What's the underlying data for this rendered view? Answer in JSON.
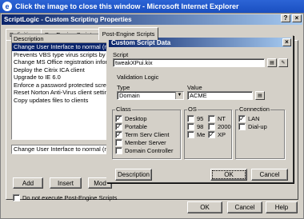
{
  "ie_window": {
    "title": "Click the image to close this window - Microsoft Internet Explorer"
  },
  "properties": {
    "title": "ScriptLogic - Custom Scripting Properties",
    "tabs": [
      "Definitions",
      "Pre-Engine Scripts",
      "Post-Engine Scripts"
    ],
    "list_header": "Description",
    "items": [
      "Change User Interface to normal (non-XP",
      "Prevents VBS type virus scripts by de-as",
      "Change MS Office registration informatio",
      "Deploy the Citrix ICA client",
      "Upgrade to IE 6.0",
      "Enforce a password protected screen sa",
      "Reset Norton Anti-Virus client settings",
      "Copy updates files to clients"
    ],
    "selected_description": "Change User Interface to normal (non-XP",
    "buttons": {
      "add": "Add",
      "insert": "Insert",
      "modify": "Mod"
    },
    "do_not_execute_label": "Do not execute Post-Engine Scripts",
    "footer": {
      "ok": "OK",
      "cancel": "Cancel",
      "help": "Help"
    }
  },
  "dialog": {
    "title": "Custom Script Data",
    "script_label": "Script",
    "script_value": "tweakXPui.kix",
    "validation_label": "Validation Logic",
    "type_label": "Type",
    "type_value": "Domain",
    "value_label": "Value",
    "value_value": "ACME",
    "class": {
      "title": "Class",
      "options": [
        {
          "label": "Desktop",
          "checked": true
        },
        {
          "label": "Portable",
          "checked": true
        },
        {
          "label": "Term Serv Client",
          "checked": true
        },
        {
          "label": "Member Server",
          "checked": false
        },
        {
          "label": "Domain Controller",
          "checked": false
        }
      ]
    },
    "os": {
      "title": "OS",
      "options": [
        {
          "label": "95",
          "checked": false
        },
        {
          "label": "NT",
          "checked": false
        },
        {
          "label": "98",
          "checked": false
        },
        {
          "label": "2000",
          "checked": false
        },
        {
          "label": "Me",
          "checked": false
        },
        {
          "label": "XP",
          "checked": true
        }
      ]
    },
    "connection": {
      "title": "Connection",
      "options": [
        {
          "label": "LAN",
          "checked": true
        },
        {
          "label": "Dial-up",
          "checked": false
        }
      ]
    },
    "buttons": {
      "description": "Description",
      "ok": "OK",
      "cancel": "Cancel"
    }
  }
}
